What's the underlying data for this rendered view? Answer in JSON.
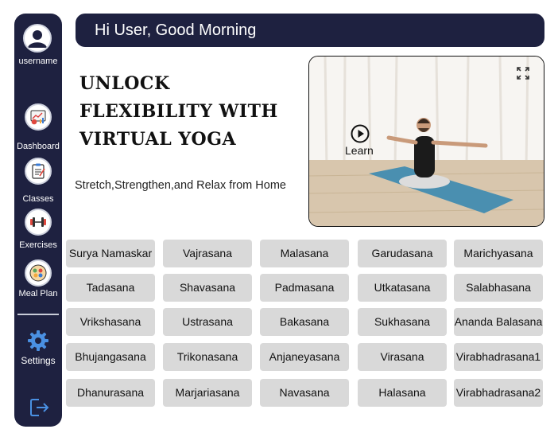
{
  "sidebar": {
    "profile_label": "username",
    "items": [
      {
        "label": "Dashboard",
        "icon": "dashboard-icon"
      },
      {
        "label": "Classes",
        "icon": "classes-icon"
      },
      {
        "label": "Exercises",
        "icon": "exercises-icon"
      },
      {
        "label": "Meal Plan",
        "icon": "meal-plan-icon"
      }
    ],
    "settings_label": "Settings",
    "logout_icon": "logout-icon"
  },
  "header": {
    "greeting": "Hi User, Good Morning"
  },
  "hero": {
    "title_line1": "UNLOCK",
    "title_line2": "FLEXIBILITY WITH",
    "title_line3": "VIRTUAL YOGA",
    "subtitle": "Stretch,Strengthen,and Relax from Home"
  },
  "video": {
    "learn_label": "Learn",
    "play_icon": "play-icon",
    "fullscreen_icon": "fullscreen-icon"
  },
  "poses": [
    [
      "Surya Namaskar",
      "Vajrasana",
      "Malasana",
      "Garudasana",
      "Marichyasana"
    ],
    [
      "Tadasana",
      "Shavasana",
      "Padmasana",
      "Utkatasana",
      "Salabhasana"
    ],
    [
      "Vrikshasana",
      "Ustrasana",
      "Bakasana",
      "Sukhasana",
      "Ananda Balasana"
    ],
    [
      "Bhujangasana",
      "Trikonasana",
      "Anjaneyasana",
      "Virasana",
      "Virabhadrasana1"
    ],
    [
      "Dhanurasana",
      "Marjariasana",
      "Navasana",
      "Halasana",
      "Virabhadrasana2"
    ]
  ],
  "colors": {
    "sidebar_bg": "#1e2140",
    "header_bg": "#1e2140",
    "pose_button_bg": "#d9d9d9",
    "mat": "#4a8fb0"
  }
}
